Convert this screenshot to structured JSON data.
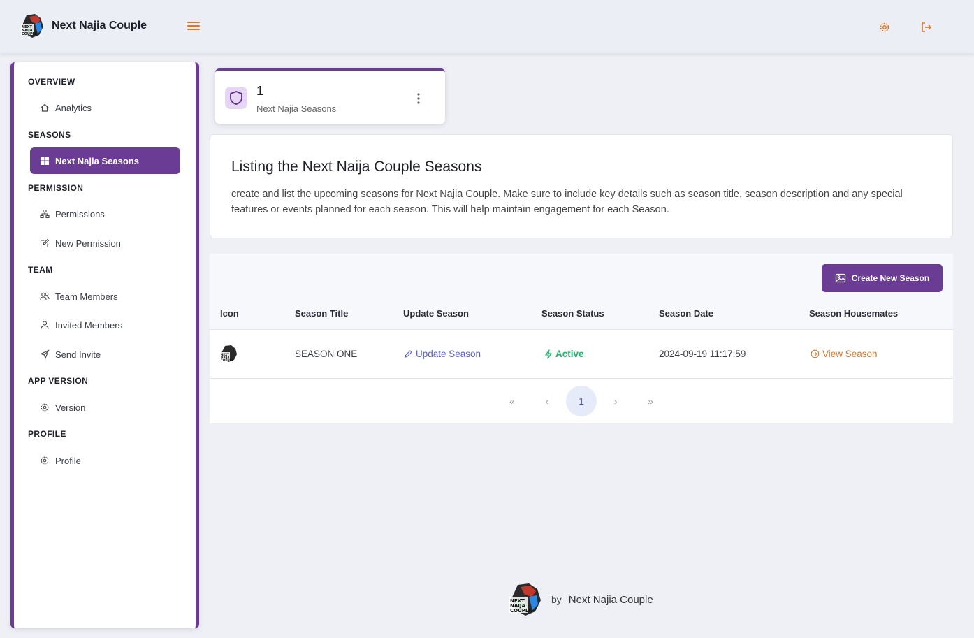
{
  "header": {
    "brand_title": "Next Najia Couple"
  },
  "sidebar": {
    "sections": {
      "overview": "OVERVIEW",
      "seasons": "SEASONS",
      "permission": "PERMISSION",
      "team": "TEAM",
      "app_version": "APP VERSION",
      "profile": "PROFILE"
    },
    "items": {
      "analytics": "Analytics",
      "next_najia_seasons": "Next Najia Seasons",
      "permissions": "Permissions",
      "new_permission": "New Permission",
      "team_members": "Team Members",
      "invited_members": "Invited Members",
      "send_invite": "Send Invite",
      "version": "Version",
      "profile": "Profile"
    }
  },
  "stat_card": {
    "count": "1",
    "label": "Next Najia Seasons"
  },
  "info": {
    "title": "Listing the Next Naija Couple Seasons",
    "description": "create and list the upcoming seasons for Next Najia Couple. Make sure to include key details such as season title, season description and any special features or events planned for each season. This will help maintain engagement for each Season."
  },
  "table": {
    "create_button": "Create New Season",
    "columns": [
      "Icon",
      "Season Title",
      "Update Season",
      "Season Status",
      "Season Date",
      "Season Housemates"
    ],
    "rows": [
      {
        "title": "SEASON ONE",
        "update": "Update Season",
        "status": "Active",
        "date": "2024-09-19 11:17:59",
        "housemates": "View Season"
      }
    ]
  },
  "pagination": {
    "first": "«",
    "prev": "‹",
    "current": "1",
    "next": "›",
    "last": "»"
  },
  "footer": {
    "by": "by",
    "name": "Next Najia Couple"
  },
  "colors": {
    "primary": "#6a3c93",
    "accent": "#d8782a",
    "success": "#1fb36b",
    "link": "#5a62c8"
  }
}
